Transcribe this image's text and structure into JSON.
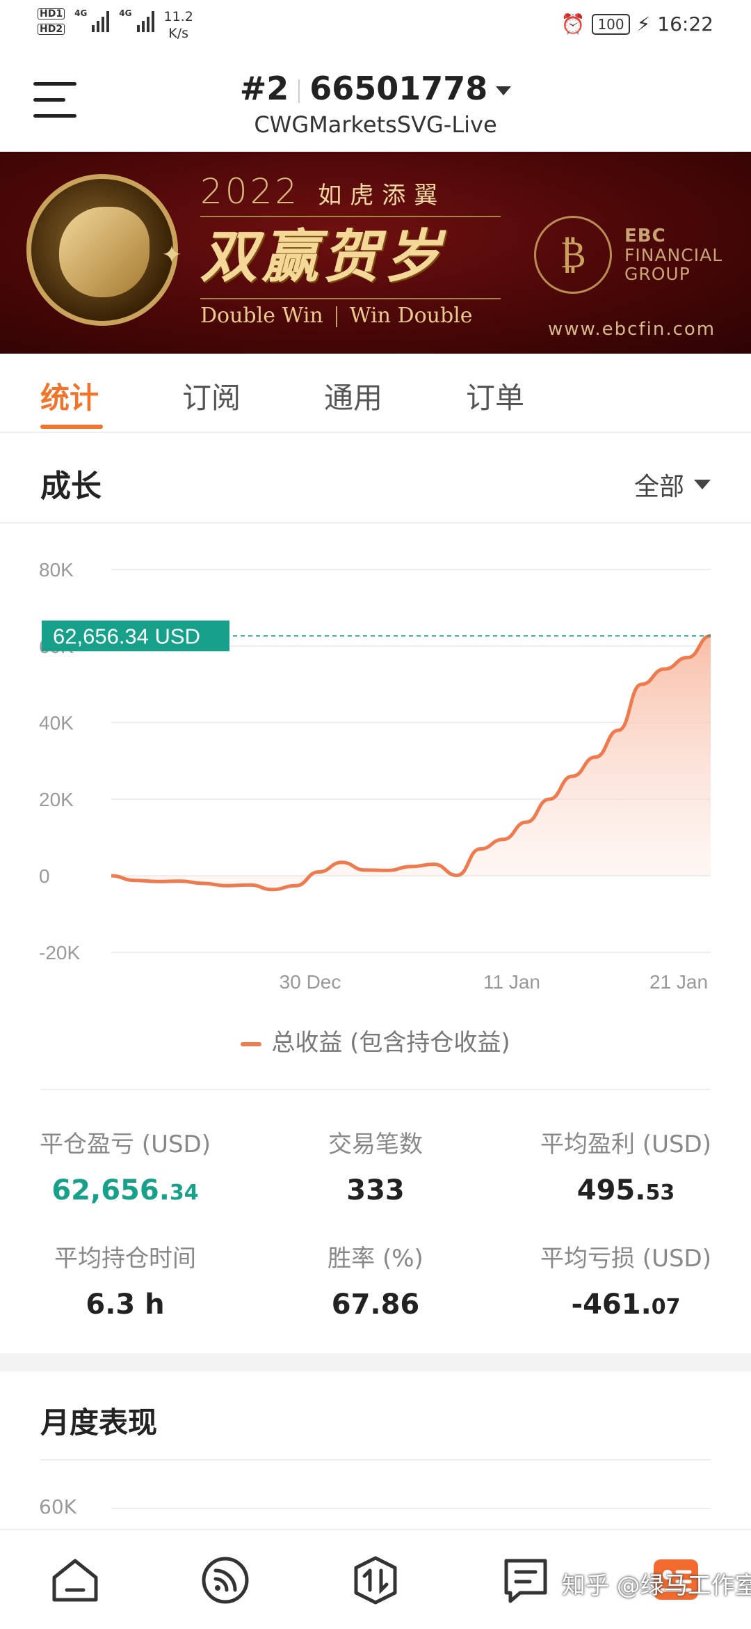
{
  "status_bar": {
    "hd_labels": [
      "HD1",
      "HD2"
    ],
    "network_1": "4G",
    "network_2": "4G",
    "speed_value": "11.2",
    "speed_unit": "K/s",
    "battery": "100",
    "time": "16:22"
  },
  "header": {
    "account_prefix": "#2",
    "account_number": "66501778",
    "server": "CWGMarketsSVG-Live"
  },
  "banner": {
    "year": "2022",
    "idiom": "如虎添翼",
    "headline": "双赢贺岁",
    "tagline_left": "Double Win",
    "tagline_right": "Win Double",
    "brand_short": "EBC",
    "brand_line2": "FINANCIAL",
    "brand_line3": "GROUP",
    "url": "www.ebcfin.com"
  },
  "tabs": [
    {
      "label": "统计",
      "active": true
    },
    {
      "label": "订阅",
      "active": false
    },
    {
      "label": "通用",
      "active": false
    },
    {
      "label": "订单",
      "active": false
    }
  ],
  "growth": {
    "title": "成长",
    "filter": "全部"
  },
  "chart_data": {
    "type": "area",
    "title": "",
    "ylabel": "",
    "xlabel": "",
    "ylim": [
      -20000,
      80000
    ],
    "y_ticks": [
      "80K",
      "60K",
      "40K",
      "20K",
      "0",
      "-20K"
    ],
    "x_ticks": [
      "30 Dec",
      "11 Jan",
      "21 Jan"
    ],
    "current_value_label": "62,656.34 USD",
    "current_value": 62656.34,
    "series": [
      {
        "name": "总收益 (包含持仓收益)",
        "color": "#ee7a4e",
        "values": [
          0,
          -1200,
          -1500,
          -1400,
          -2000,
          -2600,
          -2400,
          -3600,
          -2600,
          1000,
          3500,
          1500,
          1400,
          2400,
          3000,
          100,
          7000,
          9500,
          14000,
          20000,
          26000,
          31000,
          38000,
          50000,
          54000,
          57000,
          62656.34
        ]
      }
    ]
  },
  "legend_label": "总收益 (包含持仓收益)",
  "stats": [
    {
      "label": "平仓盈亏 (USD)",
      "value_main": "62,656.",
      "value_cents": "34",
      "positive": true
    },
    {
      "label": "交易笔数",
      "value_main": "333",
      "value_cents": ""
    },
    {
      "label": "平均盈利 (USD)",
      "value_main": "495.",
      "value_cents": "53"
    },
    {
      "label": "平均持仓时间",
      "value_main": "6.3 h",
      "value_cents": ""
    },
    {
      "label": "胜率 (%)",
      "value_main": "67.86",
      "value_cents": ""
    },
    {
      "label": "平均亏损 (USD)",
      "value_main": "-461.",
      "value_cents": "07"
    }
  ],
  "monthly": {
    "title": "月度表现",
    "first_tick": "60K"
  },
  "bottom_nav": {
    "icons": [
      "home-icon",
      "feed-icon",
      "trade-icon",
      "orders-icon",
      "profile-icon"
    ]
  },
  "watermark": "知乎 @绿马工作室"
}
